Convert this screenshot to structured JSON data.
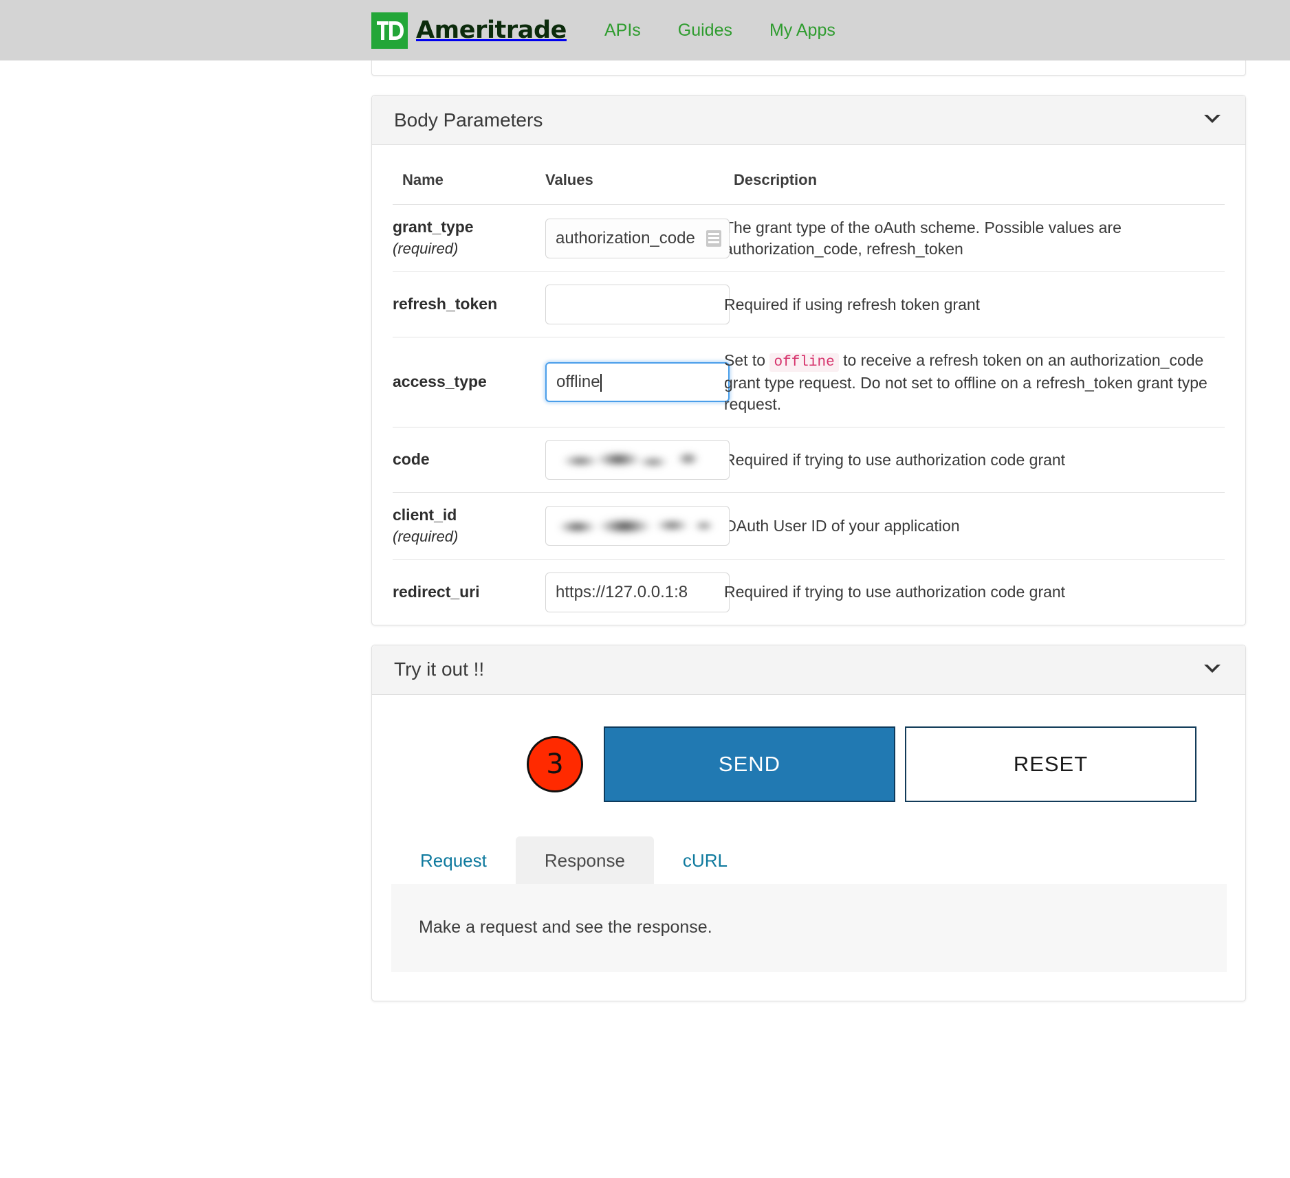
{
  "header": {
    "brand": "Ameritrade",
    "logo_mark": "TD",
    "nav": [
      {
        "label": "APIs"
      },
      {
        "label": "Guides"
      },
      {
        "label": "My Apps"
      }
    ]
  },
  "body_params_card": {
    "title": "Body Parameters",
    "chevron": "⌄",
    "columns": [
      "Name",
      "Values",
      "Description"
    ],
    "rows": [
      {
        "name": "grant_type",
        "required_note": "(required)",
        "control": "select",
        "value": "authorization_code",
        "options": [
          "authorization_code",
          "refresh_token"
        ],
        "description_pre": "The grant type of the oAuth scheme. Possible values are authorization_code, refresh_token"
      },
      {
        "name": "refresh_token",
        "required_note": "",
        "control": "input",
        "value": "",
        "placeholder": "",
        "description_pre": "Required if using refresh token grant"
      },
      {
        "name": "access_type",
        "required_note": "",
        "control": "input-focused",
        "value": "offline",
        "description_pre": "Set to ",
        "description_code": "offline",
        "description_post": " to receive a refresh token on an authorization_code grant type request. Do not set to offline on a refresh_token grant type request."
      },
      {
        "name": "code",
        "required_note": "",
        "control": "redacted",
        "value": "",
        "description_pre": "Required if trying to use authorization code grant"
      },
      {
        "name": "client_id",
        "required_note": "(required)",
        "control": "redacted-wide",
        "value": "",
        "description_pre": "OAuth User ID of your application"
      },
      {
        "name": "redirect_uri",
        "required_note": "",
        "control": "text",
        "value": "https://127.0.0.1:8",
        "description_pre": "Required if trying to use authorization code grant"
      }
    ]
  },
  "tryout_card": {
    "title": "Try it out !!",
    "chevron": "⌄",
    "step_marker": "3",
    "send_label": "SEND",
    "reset_label": "RESET",
    "tabs": [
      {
        "label": "Request",
        "active": false
      },
      {
        "label": "Response",
        "active": true
      },
      {
        "label": "cURL",
        "active": false
      }
    ],
    "response_placeholder": "Make a request and see the response."
  },
  "colors": {
    "brand_green": "#23a638",
    "nav_link": "#2e9c2e",
    "send_bg": "#2179b2",
    "send_border": "#0d3a5c",
    "reset_border": "#123b59",
    "marker_red": "#ff2a00",
    "tab_link": "#0f7a9e",
    "code_pink": "#d6336c",
    "topbar_bg": "#d4d4d4"
  }
}
